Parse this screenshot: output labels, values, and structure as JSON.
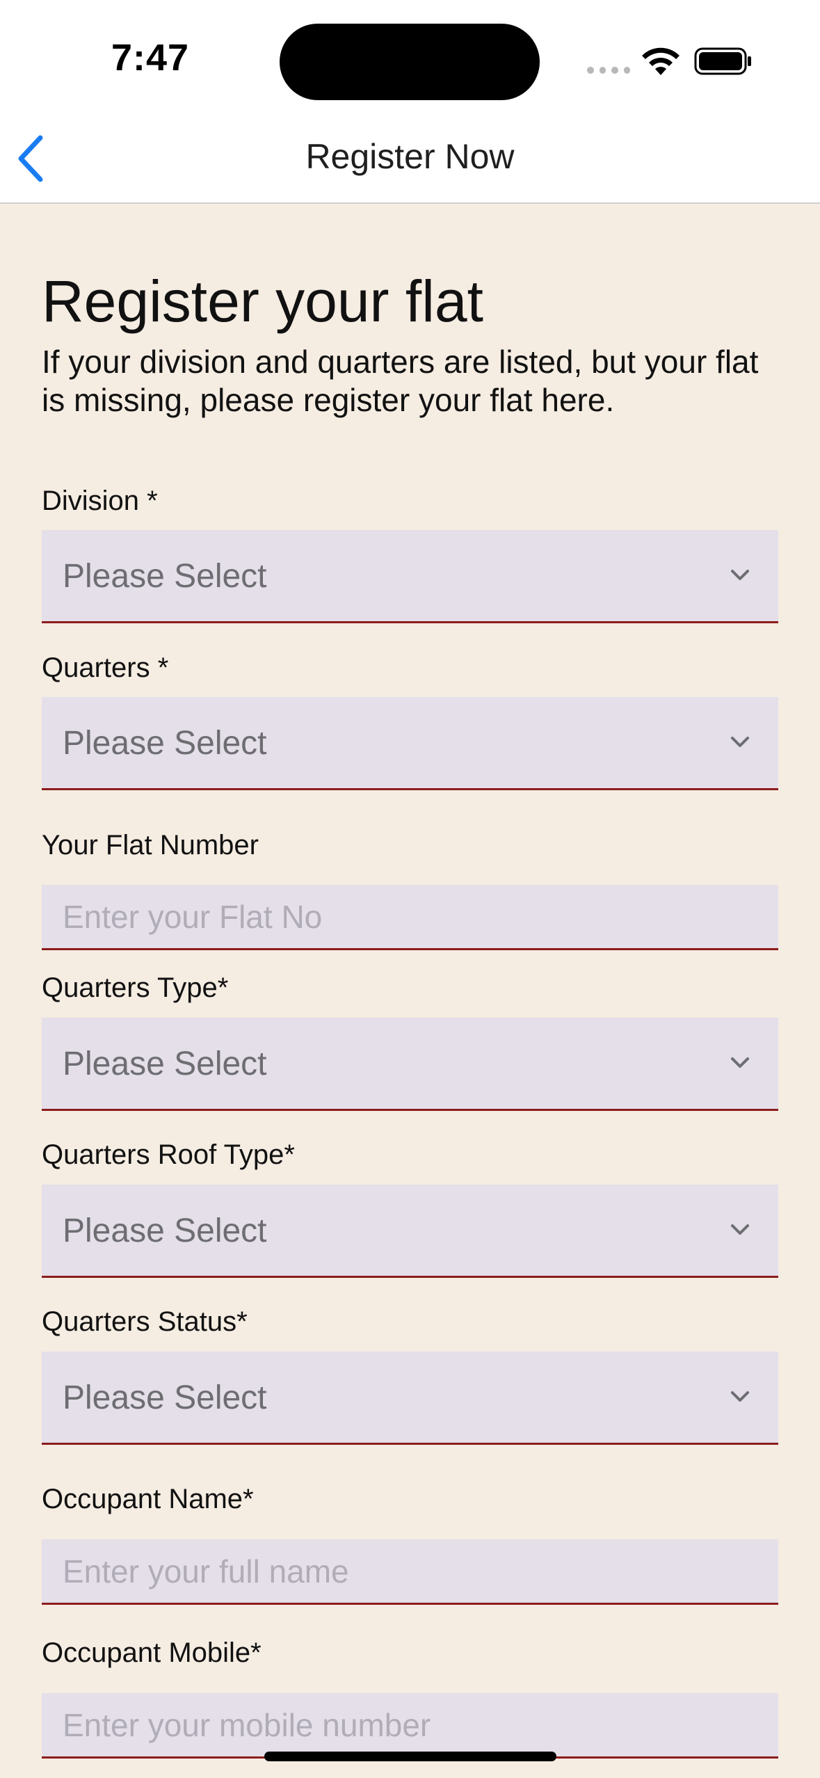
{
  "status_bar": {
    "time": "7:47"
  },
  "nav": {
    "title": "Register Now"
  },
  "page": {
    "title": "Register your flat",
    "description": "If your division and quarters are listed, but your flat is missing, please register your flat here."
  },
  "form": {
    "division": {
      "label": "Division *",
      "value": "Please Select"
    },
    "quarters": {
      "label": "Quarters *",
      "value": "Please Select"
    },
    "flat_number": {
      "label": "Your Flat Number",
      "placeholder": "Enter your Flat No"
    },
    "quarters_type": {
      "label": "Quarters Type*",
      "value": "Please Select"
    },
    "roof_type": {
      "label": "Quarters Roof Type*",
      "value": "Please Select"
    },
    "quarters_status": {
      "label": "Quarters Status*",
      "value": "Please Select"
    },
    "occupant_name": {
      "label": "Occupant Name*",
      "placeholder": "Enter your full name"
    },
    "occupant_mobile": {
      "label": "Occupant Mobile*",
      "placeholder": "Enter your mobile number"
    }
  },
  "colors": {
    "background": "#f5ece2",
    "field_background": "#e4dfe9",
    "field_underline": "#8c1c1c",
    "accent": "#1a7cf2"
  }
}
